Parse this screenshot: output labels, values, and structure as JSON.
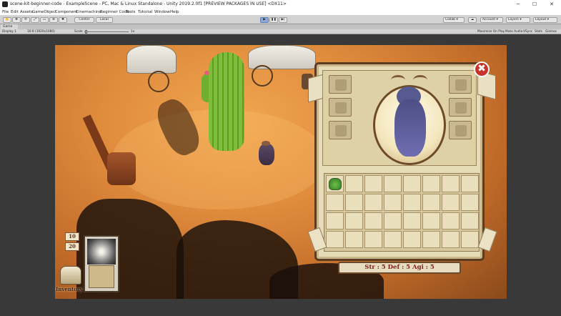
{
  "window": {
    "title": "scene-kit-beginner-code - ExampleScene - PC, Mac & Linux Standalone - Unity 2019.2.0f1 [PREVIEW PACKAGES IN USE] <DX11>",
    "minimize": "─",
    "maximize": "☐",
    "close": "✕"
  },
  "menu": [
    "File",
    "Edit",
    "Assets",
    "GameObject",
    "Component",
    "Cinemachine",
    "Beginner Code",
    "Tools",
    "Tutorial",
    "Window",
    "Help"
  ],
  "toolbar": {
    "pivot_label": "Center",
    "space_label": "Local",
    "play_icon": "▶",
    "pause_icon": "❚❚",
    "step_icon": "▶|",
    "collab_label": "Collab ▾",
    "account_label": "Account ▾",
    "layers_label": "Layers ▾",
    "layout_label": "Layout ▾"
  },
  "game_tab": {
    "label": "Game"
  },
  "game_toolbar": {
    "display": "Display 1",
    "resolution": "16:9 (1920x1080)",
    "scale_label": "Scale",
    "scale_value": "1x",
    "maximize_on_play": "Maximize On Play",
    "mute_audio": "Mute Audio",
    "vsync": "VSync",
    "stats": "Stats",
    "gizmos": "Gizmos"
  },
  "inventory_panel": {
    "close_label": "✖",
    "stats_text": "Str : 5 Def : 5 Agi : 5",
    "item_slot_0": "potion-icon"
  },
  "hud": {
    "value_top": "10",
    "value_bottom": "20",
    "inventory_label": "Inventory"
  },
  "colors": {
    "stats_text": "#7e1d1d",
    "close_button": "#c8322a",
    "play_active": "#8ea9d6"
  }
}
